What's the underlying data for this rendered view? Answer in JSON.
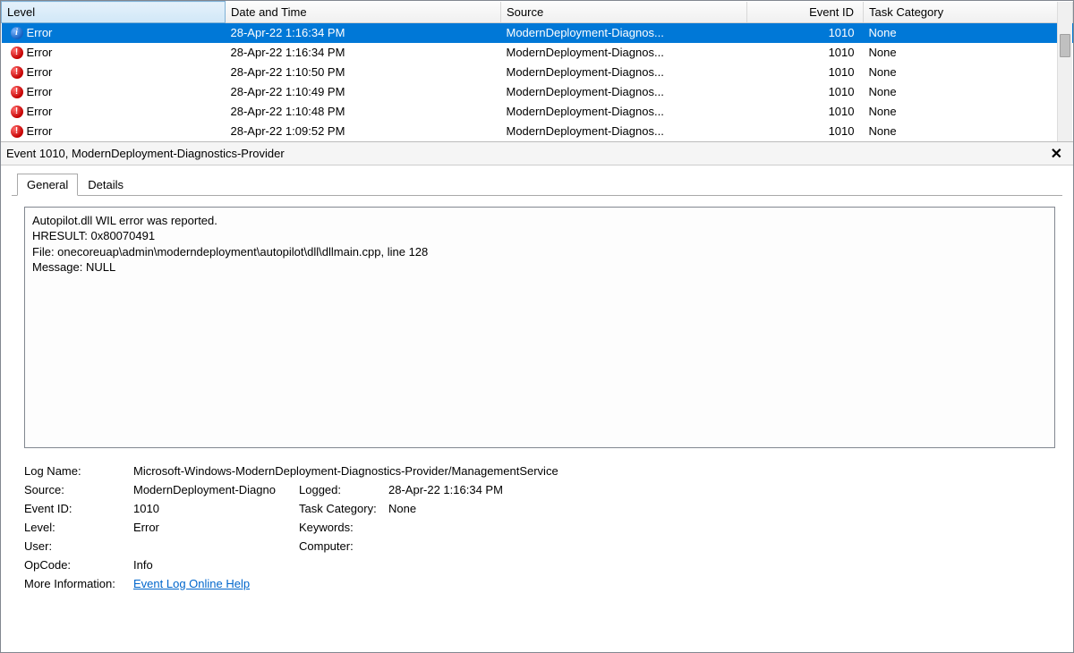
{
  "columns": {
    "level": "Level",
    "datetime": "Date and Time",
    "source": "Source",
    "eventid": "Event ID",
    "category": "Task Category"
  },
  "rows": [
    {
      "icon": "info",
      "level": "Error",
      "dt": "28-Apr-22 1:16:34 PM",
      "src": "ModernDeployment-Diagnos...",
      "id": "1010",
      "cat": "None",
      "selected": true
    },
    {
      "icon": "error",
      "level": "Error",
      "dt": "28-Apr-22 1:16:34 PM",
      "src": "ModernDeployment-Diagnos...",
      "id": "1010",
      "cat": "None"
    },
    {
      "icon": "error",
      "level": "Error",
      "dt": "28-Apr-22 1:10:50 PM",
      "src": "ModernDeployment-Diagnos...",
      "id": "1010",
      "cat": "None"
    },
    {
      "icon": "error",
      "level": "Error",
      "dt": "28-Apr-22 1:10:49 PM",
      "src": "ModernDeployment-Diagnos...",
      "id": "1010",
      "cat": "None"
    },
    {
      "icon": "error",
      "level": "Error",
      "dt": "28-Apr-22 1:10:48 PM",
      "src": "ModernDeployment-Diagnos...",
      "id": "1010",
      "cat": "None"
    },
    {
      "icon": "error",
      "level": "Error",
      "dt": "28-Apr-22 1:09:52 PM",
      "src": "ModernDeployment-Diagnos...",
      "id": "1010",
      "cat": "None"
    }
  ],
  "detail": {
    "title": "Event 1010, ModernDeployment-Diagnostics-Provider",
    "tabs": {
      "general": "General",
      "details": "Details"
    },
    "message": "Autopilot.dll WIL error was reported.\nHRESULT: 0x80070491\nFile: onecoreuap\\admin\\moderndeployment\\autopilot\\dll\\dllmain.cpp, line 128\nMessage: NULL",
    "labels": {
      "logname": "Log Name:",
      "source": "Source:",
      "eventid": "Event ID:",
      "level": "Level:",
      "user": "User:",
      "opcode": "OpCode:",
      "moreinfo": "More Information:",
      "logged": "Logged:",
      "category": "Task Category:",
      "keywords": "Keywords:",
      "computer": "Computer:"
    },
    "values": {
      "logname": "Microsoft-Windows-ModernDeployment-Diagnostics-Provider/ManagementService",
      "source": "ModernDeployment-Diagno",
      "logged": "28-Apr-22 1:16:34 PM",
      "eventid": "1010",
      "category": "None",
      "level": "Error",
      "keywords": "",
      "user": "",
      "computer": "",
      "opcode": "Info",
      "moreinfo": "Event Log Online Help"
    }
  }
}
